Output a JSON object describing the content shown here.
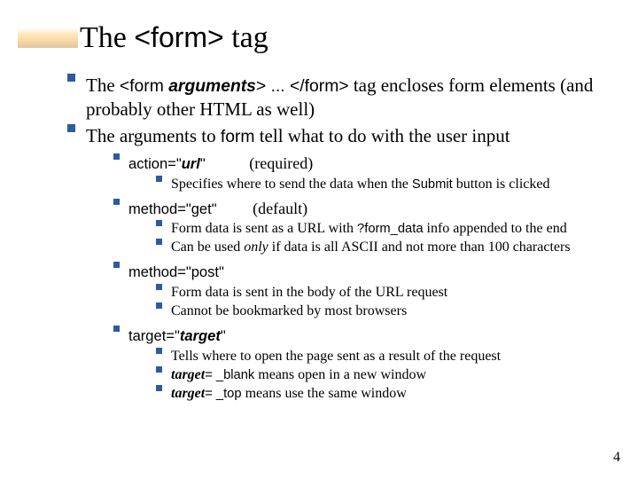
{
  "title": {
    "pre": "The ",
    "code": "<form>",
    "post": " tag"
  },
  "b1": {
    "p1a": "The ",
    "p1b": "<form ",
    "p1c": "arguments",
    "p1d": "> ... </form>",
    "p1e": " tag encloses form elements (and probably other HTML as well)",
    "p2a": "The arguments to ",
    "p2b": "form",
    "p2c": " tell what to do with the user input"
  },
  "action": {
    "head_a": "action=\"",
    "head_b": "url",
    "head_c": "\"",
    "note": "(required)",
    "sub1a": "Specifies where to send the data when the ",
    "sub1b": "Submit",
    "sub1c": " button is clicked"
  },
  "mget": {
    "head": "method=\"get\"",
    "note": "(default)",
    "sub1a": "Form data is sent as a URL with ",
    "sub1b": "?form_data",
    "sub1c": " info appended to the end",
    "sub2a": "Can be used ",
    "sub2b": "only",
    "sub2c": " if data is all ASCII and not more than 100 characters"
  },
  "mpost": {
    "head": "method=\"post\"",
    "sub1": "Form data is sent in the body of the URL request",
    "sub2": "Cannot be bookmarked by most browsers"
  },
  "target": {
    "head_a": "target=\"",
    "head_b": "target",
    "head_c": "\"",
    "sub1": "Tells where to open the page sent as a result of the request",
    "sub2a": "target",
    "sub2b": "= _blank",
    "sub2c": " means open in a new window",
    "sub3a": "target",
    "sub3b": "= _top",
    "sub3c": " means use the same window"
  },
  "slide_number": "4"
}
